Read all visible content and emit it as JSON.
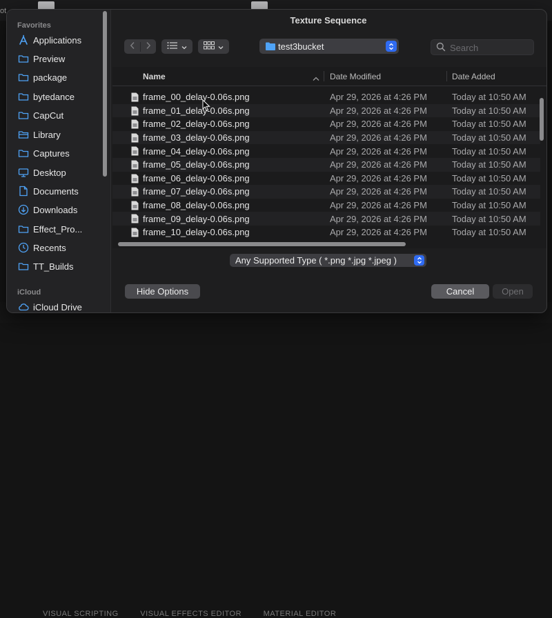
{
  "background": {
    "left_text": "ot",
    "bottom_tabs": [
      "VISUAL SCRIPTING",
      "VISUAL EFFECTS EDITOR",
      "MATERIAL EDITOR"
    ]
  },
  "dialog": {
    "title": "Texture Sequence",
    "sidebar": {
      "favorites_label": "Favorites",
      "icloud_label": "iCloud",
      "items": [
        {
          "label": "Applications",
          "icon": "applications-icon"
        },
        {
          "label": "Preview",
          "icon": "folder-icon"
        },
        {
          "label": "package",
          "icon": "folder-icon"
        },
        {
          "label": "bytedance",
          "icon": "folder-icon"
        },
        {
          "label": "CapCut",
          "icon": "folder-icon"
        },
        {
          "label": "Library",
          "icon": "library-icon"
        },
        {
          "label": "Captures",
          "icon": "folder-icon"
        },
        {
          "label": "Desktop",
          "icon": "desktop-icon"
        },
        {
          "label": "Documents",
          "icon": "document-icon"
        },
        {
          "label": "Downloads",
          "icon": "download-icon"
        },
        {
          "label": "Effect_Pro...",
          "icon": "folder-icon"
        },
        {
          "label": "Recents",
          "icon": "clock-icon"
        },
        {
          "label": "TT_Builds",
          "icon": "folder-icon"
        }
      ],
      "icloud_items": [
        {
          "label": "iCloud Drive",
          "icon": "cloud-icon"
        }
      ]
    },
    "toolbar": {
      "path_label": "test3bucket",
      "search_placeholder": "Search"
    },
    "browser": {
      "columns": [
        "Name",
        "Date Modified",
        "Date Added"
      ],
      "files": [
        {
          "name": "frame_00_delay-0.06s.png",
          "modified": "Apr 29, 2026 at 4:26 PM",
          "added": "Today at 10:50 AM"
        },
        {
          "name": "frame_01_delay-0.06s.png",
          "modified": "Apr 29, 2026 at 4:26 PM",
          "added": "Today at 10:50 AM"
        },
        {
          "name": "frame_02_delay-0.06s.png",
          "modified": "Apr 29, 2026 at 4:26 PM",
          "added": "Today at 10:50 AM"
        },
        {
          "name": "frame_03_delay-0.06s.png",
          "modified": "Apr 29, 2026 at 4:26 PM",
          "added": "Today at 10:50 AM"
        },
        {
          "name": "frame_04_delay-0.06s.png",
          "modified": "Apr 29, 2026 at 4:26 PM",
          "added": "Today at 10:50 AM"
        },
        {
          "name": "frame_05_delay-0.06s.png",
          "modified": "Apr 29, 2026 at 4:26 PM",
          "added": "Today at 10:50 AM"
        },
        {
          "name": "frame_06_delay-0.06s.png",
          "modified": "Apr 29, 2026 at 4:26 PM",
          "added": "Today at 10:50 AM"
        },
        {
          "name": "frame_07_delay-0.06s.png",
          "modified": "Apr 29, 2026 at 4:26 PM",
          "added": "Today at 10:50 AM"
        },
        {
          "name": "frame_08_delay-0.06s.png",
          "modified": "Apr 29, 2026 at 4:26 PM",
          "added": "Today at 10:50 AM"
        },
        {
          "name": "frame_09_delay-0.06s.png",
          "modified": "Apr 29, 2026 at 4:26 PM",
          "added": "Today at 10:50 AM"
        },
        {
          "name": "frame_10_delay-0.06s.png",
          "modified": "Apr 29, 2026 at 4:26 PM",
          "added": "Today at 10:50 AM"
        }
      ]
    },
    "format_label": "Any Supported Type ( *.png *.jpg *.jpeg )",
    "buttons": {
      "hide_options": "Hide Options",
      "cancel": "Cancel",
      "open": "Open"
    },
    "colors": {
      "accent": "#2f6bf2",
      "folder_blue": "#4fa3f7"
    }
  }
}
